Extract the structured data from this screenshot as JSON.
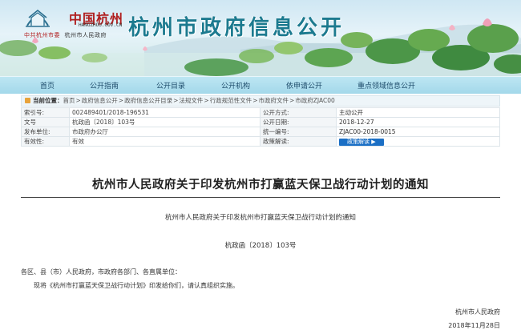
{
  "header": {
    "logo_title": "中国杭州",
    "logo_url": "HANGZHOU.GOV.CN",
    "logo_sub_party": "中共杭州市委",
    "logo_sub_gov": "杭州市人民政府",
    "site_title": "杭州市政府信息公开"
  },
  "nav": {
    "items": [
      "首页",
      "公开指南",
      "公开目录",
      "公开机构",
      "依申请公开",
      "重点领域信息公开"
    ]
  },
  "breadcrumb": {
    "label": "当前位置：",
    "items": [
      "首页",
      "政府信息公开",
      "政府信息公开目录",
      "法规文件",
      "行政规范性文件",
      "市政府文件",
      "市政府ZJAC00"
    ]
  },
  "meta": {
    "rows": [
      {
        "k1": "索引号:",
        "v1": "002489401/2018-196531",
        "k2": "公开方式:",
        "v2": "主动公开"
      },
      {
        "k1": "文号",
        "v1": "杭政函〔2018〕103号",
        "k2": "公开日期:",
        "v2": "2018-12-27"
      },
      {
        "k1": "发布单位:",
        "v1": "市政府办公厅",
        "k2": "统一编号:",
        "v2": "ZJAC00-2018-0015"
      },
      {
        "k1": "有效性:",
        "v1": "有效",
        "k2": "政策解读:",
        "v2": ""
      }
    ],
    "interpret_button": "政策解读 ▶"
  },
  "document": {
    "title": "杭州市人民政府关于印发杭州市打赢蓝天保卫战行动计划的通知",
    "subtitle": "杭州市人民政府关于印发杭州市打赢蓝天保卫战行动计划的通知",
    "number": "杭政函〔2018〕103号",
    "addressee": "各区、县（市）人民政府，市政府各部门、各直属单位：",
    "body": "现将《杭州市打赢蓝天保卫战行动计划》印发给你们，请认真组织实施。",
    "issuer": "杭州市人民政府",
    "date": "2018年11月28日"
  },
  "colors": {
    "nav_bg": "#a3d8ea",
    "site_title": "#1c7a8f",
    "logo_red": "#b01e1e",
    "button_blue": "#1b6fc5"
  }
}
